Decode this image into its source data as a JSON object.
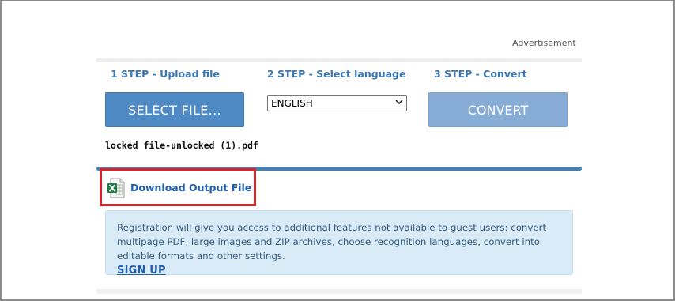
{
  "advertisement_label": "Advertisement",
  "steps": {
    "step1": "1 STEP - Upload file",
    "step2": "2 STEP - Select language",
    "step3": "3 STEP - Convert"
  },
  "buttons": {
    "select_file": "SELECT FILE...",
    "convert": "CONVERT"
  },
  "language_select": {
    "selected": "ENGLISH"
  },
  "uploaded_file": {
    "name": "locked file-unlocked (1).pdf"
  },
  "download": {
    "label": "Download Output File",
    "icon": "excel-file-icon"
  },
  "registration": {
    "message": "Registration will give you access to additional features not available to guest users: convert multipage PDF, large images and ZIP archives, choose recognition languages, convert into editable formats and other settings.",
    "signup_label": "SIGN UP"
  },
  "colors": {
    "step_text": "#3a77b5",
    "select_button": "#4f8ac4",
    "convert_button": "#87add6",
    "progress_bar": "#4a7fad",
    "highlight": "#d9242c",
    "info_box": "#d9ebf7"
  }
}
